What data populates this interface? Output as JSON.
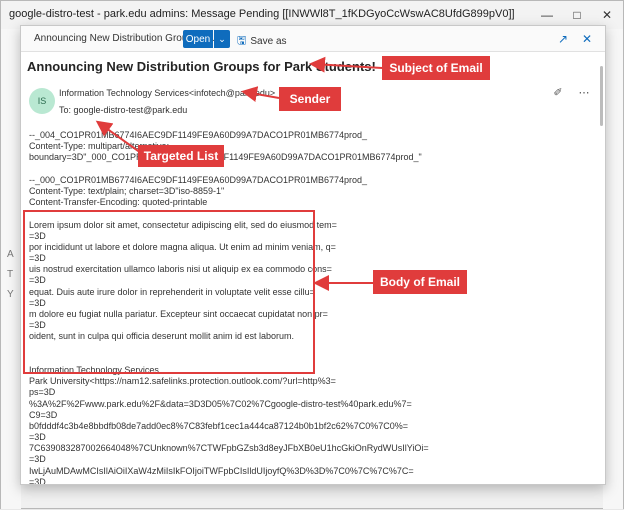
{
  "window": {
    "title": "google-distro-test - park.edu admins: Message Pending [[INWWl8T_1fKDGyoCcWswAC8UfdG899pV0]]"
  },
  "popup_toolbar": {
    "title": "Announcing New Distribution Groups fo...",
    "open_label": "Open",
    "save_label": "Save as"
  },
  "email": {
    "subject": "Announcing New Distribution Groups for Park Students!",
    "avatar_initials": "IS",
    "sender": "Information Technology Services<infotech@park.edu>",
    "to_label": "To:",
    "to_address": "google-distro-test@park.edu",
    "body_lines": [
      "--_004_CO1PR01MB6774I6AEC9DF1149FE9A60D99A7DACO1PR01MB6774prod_",
      "Content-Type: multipart/alternative;",
      "        boundary=3D\"_000_CO1PR01MB6774I6AEC9DF1149FE9A60D99A7DACO1PR01MB6774prod_\"",
      "",
      "--_000_CO1PR01MB6774I6AEC9DF1149FE9A60D99A7DACO1PR01MB6774prod_",
      "Content-Type: text/plain; charset=3D\"iso-8859-1\"",
      "Content-Transfer-Encoding: quoted-printable",
      "",
      "Lorem ipsum dolor sit amet, consectetur adipiscing elit, sed do eiusmod tem=",
      "=3D",
      "por incididunt ut labore et dolore magna aliqua. Ut enim ad minim veniam, q=",
      "=3D",
      "uis nostrud exercitation ullamco laboris nisi ut aliquip ex ea commodo cons=",
      "=3D",
      "equat. Duis aute irure dolor in reprehenderit in voluptate velit esse cillu=",
      "=3D",
      "m dolore eu fugiat nulla pariatur. Excepteur sint occaecat cupidatat non pr=",
      "=3D",
      "oident, sunt in culpa qui officia deserunt mollit anim id est laborum.",
      "",
      "",
      "Information Technology Services",
      "Park University<https://nam12.safelinks.protection.outlook.com/?url=http%3=",
      "ps=3D",
      "%3A%2F%2Fwww.park.edu%2F&data=3D3D05%7C02%7Cgoogle-distro-test%40park.edu%7=",
      "C9=3D",
      "b0fdddf4c3b4e8bbdfb08de7add0ec8%7C83febf1cec1a444ca87124b0b1bf2c62%7C0%7C0%=",
      "=3D",
      "7C639083287002664048%7CUnknown%7CTWFpbGZsb3d8eyJFbXB0eU1hcGkiOnRydWUsIlYiOi=",
      "=3D",
      "IwLjAuMDAwMCIsIlAiOiIXaW4zMiIsIkFOIjoiTWFpbCIsIldUIjoyfQ%3D%3D%7C0%7C%7C%7C=",
      "=3D"
    ]
  },
  "annotations": {
    "subject": "Subject of Email",
    "sender": "Sender",
    "targeted_list": "Targeted List",
    "body": "Body of Email"
  },
  "colors": {
    "accent": "#0f6cbd",
    "annotation": "#e03c3c",
    "avatar_bg": "#b9e8d2"
  }
}
